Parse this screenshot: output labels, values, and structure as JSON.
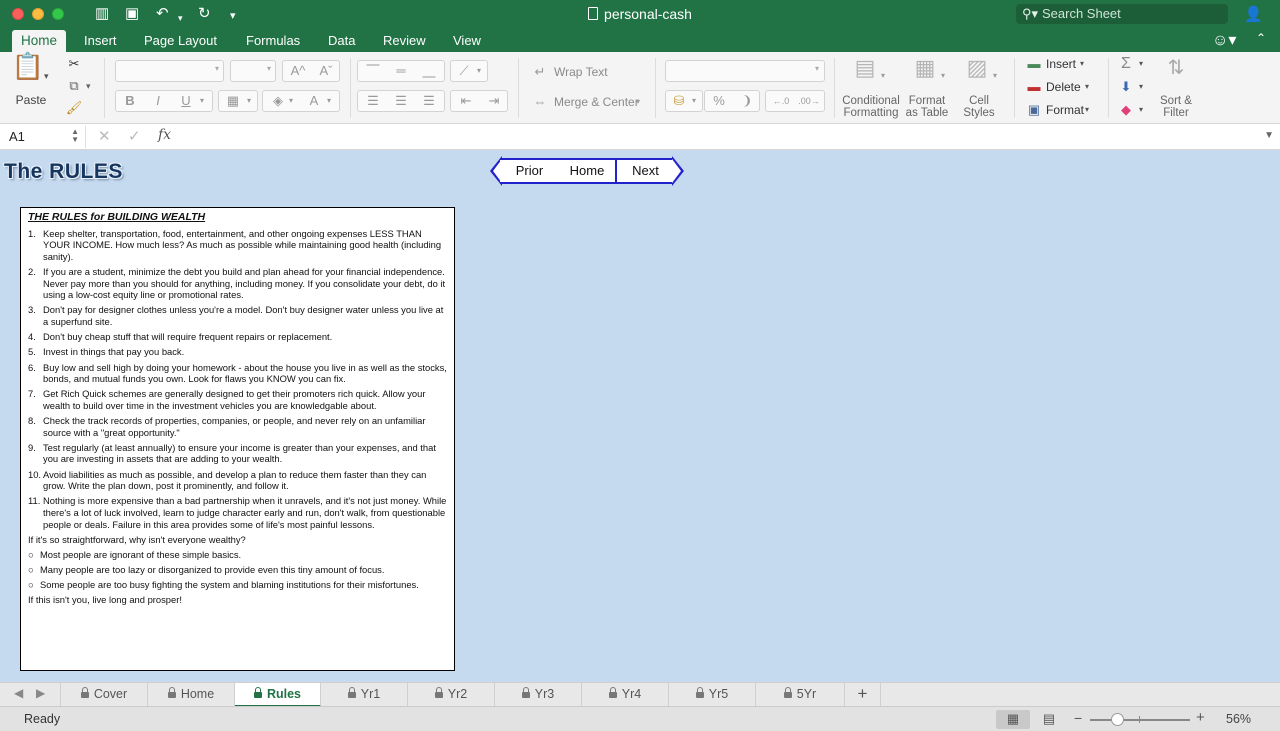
{
  "window": {
    "title": "personal-cash",
    "search_placeholder": "Search Sheet"
  },
  "ribbon_tabs": [
    "Home",
    "Insert",
    "Page Layout",
    "Formulas",
    "Data",
    "Review",
    "View"
  ],
  "ribbon": {
    "paste": "Paste",
    "wrap_text": "Wrap Text",
    "merge_center": "Merge & Center",
    "conditional_formatting": [
      "Conditional",
      "Formatting"
    ],
    "format_as_table": [
      "Format",
      "as Table"
    ],
    "cell_styles": [
      "Cell",
      "Styles"
    ],
    "insert": "Insert",
    "delete": "Delete",
    "format": "Format",
    "sort_filter": [
      "Sort &",
      "Filter"
    ],
    "bold": "B",
    "italic": "I",
    "underline": "U",
    "percent": "%"
  },
  "formula_bar": {
    "cell_ref": "A1",
    "fx": "fx",
    "value": ""
  },
  "sheet": {
    "heading": "The RULES",
    "nav": {
      "prior": "Prior",
      "home": "Home",
      "next": "Next"
    },
    "box": {
      "title": "THE RULES for BUILDING WEALTH",
      "rules": [
        {
          "n": "1.",
          "text": "Keep shelter, transportation, food, entertainment, and other ongoing expenses LESS THAN YOUR INCOME. How much less? As much as possible while maintaining good health (including sanity)."
        },
        {
          "n": "2.",
          "text": "If you are a student, minimize the debt you build and plan ahead for your financial independence. Never pay more than you should for anything, including money. If you consolidate your debt, do it using a low-cost equity line or promotional rates."
        },
        {
          "n": "3.",
          "text": "Don't pay for designer clothes unless you're a model. Don't buy designer water unless you live at a superfund site."
        },
        {
          "n": "4.",
          "text": "Don't buy cheap stuff that will require frequent repairs or replacement."
        },
        {
          "n": "5.",
          "text": "Invest in things that pay you back."
        },
        {
          "n": "6.",
          "text": "Buy low and sell high by doing your homework - about the house you live in as well as the stocks, bonds, and mutual funds you own. Look for flaws you KNOW you can fix."
        },
        {
          "n": "7.",
          "text": "Get Rich Quick schemes are generally designed to get their promoters rich quick. Allow your wealth to build over time in the investment vehicles you are knowledgable about."
        },
        {
          "n": "8.",
          "text": "Check the track records of properties, companies, or people, and never rely on an unfamiliar source with a \"great opportunity.\""
        },
        {
          "n": "9.",
          "text": "Test regularly (at least annually) to ensure your income is greater than your expenses, and that you are investing in assets that are adding to your wealth."
        },
        {
          "n": "10.",
          "text": "Avoid liabilities as much as possible, and develop a plan to reduce them faster than they can grow. Write the plan down, post it prominently, and follow it."
        },
        {
          "n": "11.",
          "text": "Nothing is more expensive than a bad partnership when it unravels, and it's not just money. While there's a lot of luck involved, learn to judge character early and run, don't walk, from questionable people or deals. Failure in this area provides some of life's most painful lessons."
        }
      ],
      "question": "If it's so straightforward, why isn't everyone wealthy?",
      "bullets": [
        "Most people are ignorant of these simple basics.",
        "Many people are too lazy or disorganized to provide even this tiny amount of focus.",
        "Some people are too busy fighting the system and blaming institutions for their misfortunes."
      ],
      "closing": "If this isn't you, live long and prosper!"
    }
  },
  "sheet_tabs": [
    "Cover",
    "Home",
    "Rules",
    "Yr1",
    "Yr2",
    "Yr3",
    "Yr4",
    "Yr5",
    "5Yr"
  ],
  "active_sheet": "Rules",
  "status": {
    "ready": "Ready",
    "zoom": "56%"
  }
}
